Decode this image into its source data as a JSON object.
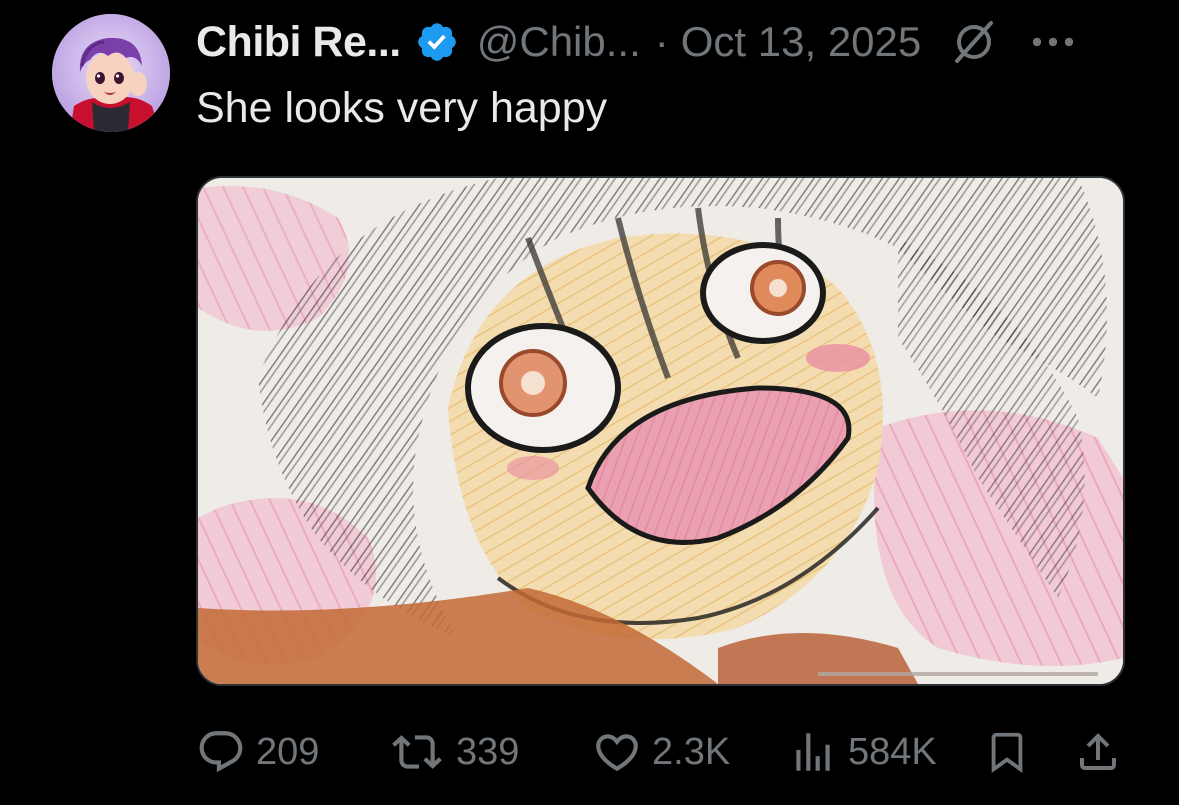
{
  "tweet": {
    "display_name": "Chibi Re...",
    "handle": "@Chib...",
    "separator": "·",
    "date": "Oct 13, 2025",
    "text": "She looks very happy",
    "avatar_icon": "avatar-cartoon-icon",
    "verified_icon": "verified-badge-icon",
    "grok_icon": "grok-icon",
    "more_icon": "more-dots-icon"
  },
  "media": {
    "kind": "image",
    "description_icon": "anime-sketch-image"
  },
  "actions": {
    "replies": {
      "icon": "reply-icon",
      "count": "209"
    },
    "reposts": {
      "icon": "repost-icon",
      "count": "339"
    },
    "likes": {
      "icon": "like-icon",
      "count": "2.3K"
    },
    "views": {
      "icon": "views-icon",
      "count": "584K"
    },
    "bookmark": {
      "icon": "bookmark-icon"
    },
    "share": {
      "icon": "share-icon"
    }
  },
  "colors": {
    "background": "#000000",
    "primary_text": "#e7e9ea",
    "secondary_text": "#71767b",
    "verified_blue": "#1d9bf0"
  }
}
